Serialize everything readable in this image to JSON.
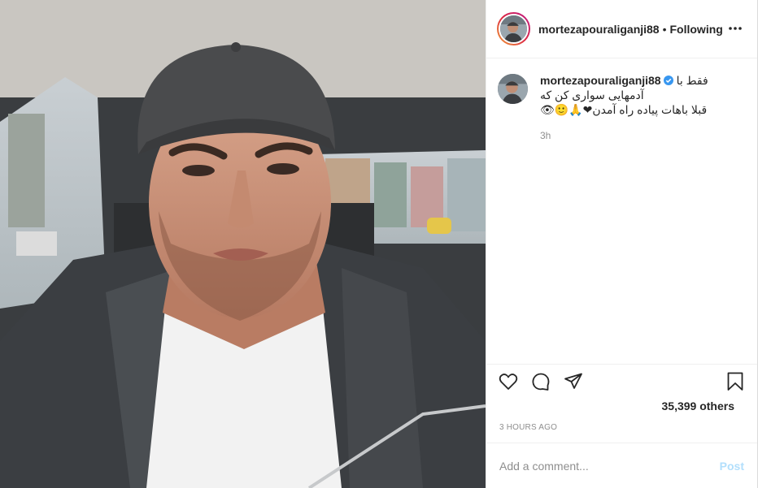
{
  "post": {
    "image_alt_subject": "man-selfie-in-car",
    "header": {
      "username": "mortezapouraliganji88",
      "separator": "•",
      "follow_state": "Following",
      "more_icon": "more-horizontal-icon"
    },
    "caption": {
      "username": "mortezapouraliganji88",
      "verified": true,
      "line1": "فقط با",
      "line2": "آدمهایی سواری کن که",
      "line3": "قبلا باهات پیاده راه آمدن",
      "emojis": "👁🙂🙏❤",
      "time": "3h"
    },
    "actions": {
      "like_icon": "heart-icon",
      "comment_icon": "comment-icon",
      "share_icon": "send-icon",
      "save_icon": "bookmark-icon"
    },
    "likes_text": "35,399 others",
    "posted_ago": "3 HOURS AGO",
    "comment": {
      "placeholder": "Add a comment...",
      "value": "",
      "post_label": "Post"
    },
    "colors": {
      "story_ring_start": "#f09433",
      "story_ring_end": "#bc1888",
      "verified_blue": "#3897f0",
      "post_disabled": "#b2dffc",
      "muted_text": "#8e8e8e"
    }
  }
}
